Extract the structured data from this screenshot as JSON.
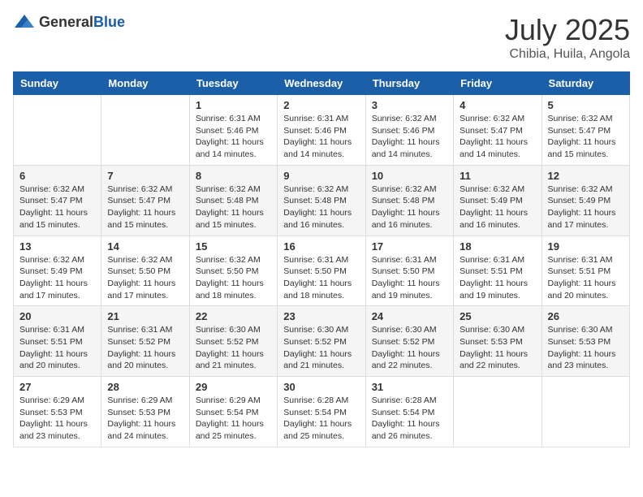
{
  "logo": {
    "general": "General",
    "blue": "Blue"
  },
  "header": {
    "month": "July 2025",
    "location": "Chibia, Huila, Angola"
  },
  "weekdays": [
    "Sunday",
    "Monday",
    "Tuesday",
    "Wednesday",
    "Thursday",
    "Friday",
    "Saturday"
  ],
  "weeks": [
    [
      {
        "day": "",
        "info": ""
      },
      {
        "day": "",
        "info": ""
      },
      {
        "day": "1",
        "info": "Sunrise: 6:31 AM\nSunset: 5:46 PM\nDaylight: 11 hours and 14 minutes."
      },
      {
        "day": "2",
        "info": "Sunrise: 6:31 AM\nSunset: 5:46 PM\nDaylight: 11 hours and 14 minutes."
      },
      {
        "day": "3",
        "info": "Sunrise: 6:32 AM\nSunset: 5:46 PM\nDaylight: 11 hours and 14 minutes."
      },
      {
        "day": "4",
        "info": "Sunrise: 6:32 AM\nSunset: 5:47 PM\nDaylight: 11 hours and 14 minutes."
      },
      {
        "day": "5",
        "info": "Sunrise: 6:32 AM\nSunset: 5:47 PM\nDaylight: 11 hours and 15 minutes."
      }
    ],
    [
      {
        "day": "6",
        "info": "Sunrise: 6:32 AM\nSunset: 5:47 PM\nDaylight: 11 hours and 15 minutes."
      },
      {
        "day": "7",
        "info": "Sunrise: 6:32 AM\nSunset: 5:47 PM\nDaylight: 11 hours and 15 minutes."
      },
      {
        "day": "8",
        "info": "Sunrise: 6:32 AM\nSunset: 5:48 PM\nDaylight: 11 hours and 15 minutes."
      },
      {
        "day": "9",
        "info": "Sunrise: 6:32 AM\nSunset: 5:48 PM\nDaylight: 11 hours and 16 minutes."
      },
      {
        "day": "10",
        "info": "Sunrise: 6:32 AM\nSunset: 5:48 PM\nDaylight: 11 hours and 16 minutes."
      },
      {
        "day": "11",
        "info": "Sunrise: 6:32 AM\nSunset: 5:49 PM\nDaylight: 11 hours and 16 minutes."
      },
      {
        "day": "12",
        "info": "Sunrise: 6:32 AM\nSunset: 5:49 PM\nDaylight: 11 hours and 17 minutes."
      }
    ],
    [
      {
        "day": "13",
        "info": "Sunrise: 6:32 AM\nSunset: 5:49 PM\nDaylight: 11 hours and 17 minutes."
      },
      {
        "day": "14",
        "info": "Sunrise: 6:32 AM\nSunset: 5:50 PM\nDaylight: 11 hours and 17 minutes."
      },
      {
        "day": "15",
        "info": "Sunrise: 6:32 AM\nSunset: 5:50 PM\nDaylight: 11 hours and 18 minutes."
      },
      {
        "day": "16",
        "info": "Sunrise: 6:31 AM\nSunset: 5:50 PM\nDaylight: 11 hours and 18 minutes."
      },
      {
        "day": "17",
        "info": "Sunrise: 6:31 AM\nSunset: 5:50 PM\nDaylight: 11 hours and 19 minutes."
      },
      {
        "day": "18",
        "info": "Sunrise: 6:31 AM\nSunset: 5:51 PM\nDaylight: 11 hours and 19 minutes."
      },
      {
        "day": "19",
        "info": "Sunrise: 6:31 AM\nSunset: 5:51 PM\nDaylight: 11 hours and 20 minutes."
      }
    ],
    [
      {
        "day": "20",
        "info": "Sunrise: 6:31 AM\nSunset: 5:51 PM\nDaylight: 11 hours and 20 minutes."
      },
      {
        "day": "21",
        "info": "Sunrise: 6:31 AM\nSunset: 5:52 PM\nDaylight: 11 hours and 20 minutes."
      },
      {
        "day": "22",
        "info": "Sunrise: 6:30 AM\nSunset: 5:52 PM\nDaylight: 11 hours and 21 minutes."
      },
      {
        "day": "23",
        "info": "Sunrise: 6:30 AM\nSunset: 5:52 PM\nDaylight: 11 hours and 21 minutes."
      },
      {
        "day": "24",
        "info": "Sunrise: 6:30 AM\nSunset: 5:52 PM\nDaylight: 11 hours and 22 minutes."
      },
      {
        "day": "25",
        "info": "Sunrise: 6:30 AM\nSunset: 5:53 PM\nDaylight: 11 hours and 22 minutes."
      },
      {
        "day": "26",
        "info": "Sunrise: 6:30 AM\nSunset: 5:53 PM\nDaylight: 11 hours and 23 minutes."
      }
    ],
    [
      {
        "day": "27",
        "info": "Sunrise: 6:29 AM\nSunset: 5:53 PM\nDaylight: 11 hours and 23 minutes."
      },
      {
        "day": "28",
        "info": "Sunrise: 6:29 AM\nSunset: 5:53 PM\nDaylight: 11 hours and 24 minutes."
      },
      {
        "day": "29",
        "info": "Sunrise: 6:29 AM\nSunset: 5:54 PM\nDaylight: 11 hours and 25 minutes."
      },
      {
        "day": "30",
        "info": "Sunrise: 6:28 AM\nSunset: 5:54 PM\nDaylight: 11 hours and 25 minutes."
      },
      {
        "day": "31",
        "info": "Sunrise: 6:28 AM\nSunset: 5:54 PM\nDaylight: 11 hours and 26 minutes."
      },
      {
        "day": "",
        "info": ""
      },
      {
        "day": "",
        "info": ""
      }
    ]
  ]
}
